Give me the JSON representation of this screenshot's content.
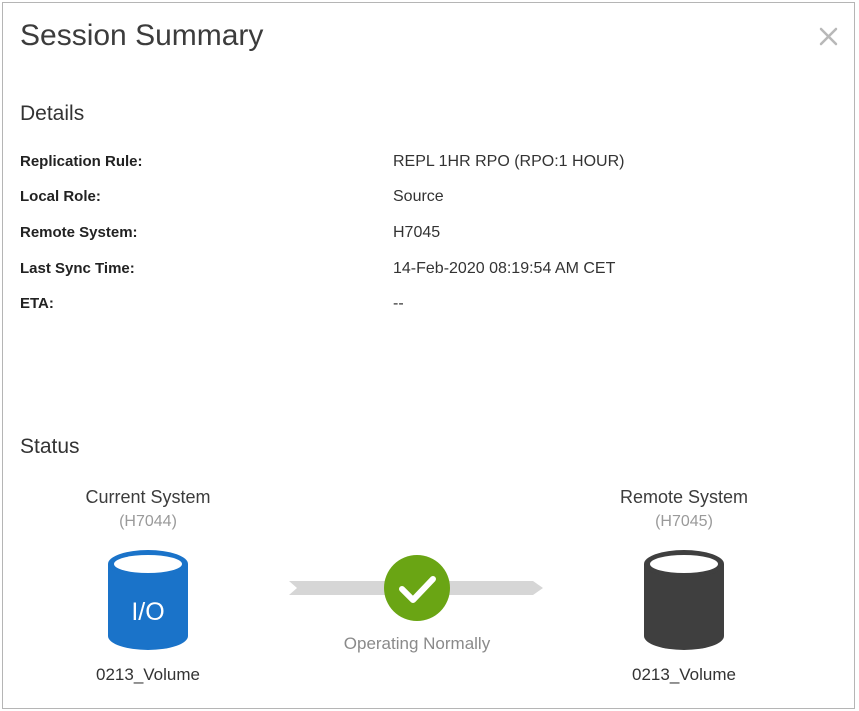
{
  "dialog": {
    "title": "Session Summary"
  },
  "details": {
    "heading": "Details",
    "rows": [
      {
        "label": "Replication Rule:",
        "value": "REPL 1HR RPO (RPO:1 HOUR)"
      },
      {
        "label": "Local Role:",
        "value": "Source"
      },
      {
        "label": "Remote System:",
        "value": "H7045"
      },
      {
        "label": "Last Sync Time:",
        "value": "14-Feb-2020 08:19:54 AM CET"
      },
      {
        "label": "ETA:",
        "value": "--"
      }
    ]
  },
  "status": {
    "heading": "Status",
    "current": {
      "title": "Current System",
      "id": "(H7044)",
      "icon_label": "I/O",
      "icon_color": "#1a73c9",
      "volume": "0213_Volume"
    },
    "remote": {
      "title": "Remote System",
      "id": "(H7045)",
      "icon_color": "#3f3f3f",
      "volume": "0213_Volume"
    },
    "link": {
      "state": "Operating Normally",
      "state_icon": "check-circle-icon",
      "state_color": "#6aa514"
    }
  }
}
